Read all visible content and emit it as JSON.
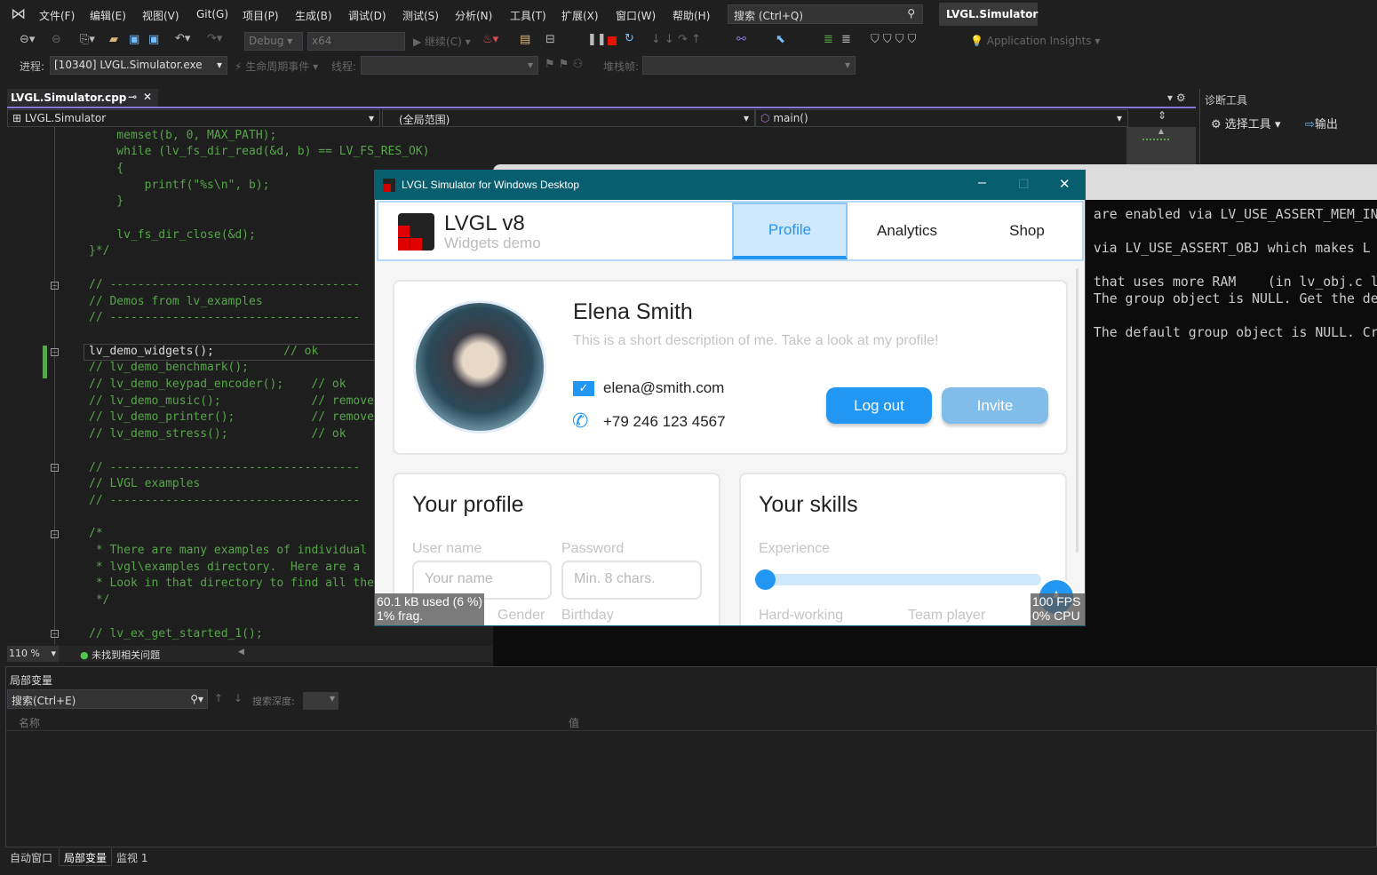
{
  "menubar": {
    "items": [
      "文件(F)",
      "编辑(E)",
      "视图(V)",
      "Git(G)",
      "项目(P)",
      "生成(B)",
      "调试(D)",
      "测试(S)",
      "分析(N)",
      "工具(T)",
      "扩展(X)",
      "窗口(W)",
      "帮助(H)"
    ],
    "search_placeholder": "搜索 (Ctrl+Q)",
    "solution": "LVGL.Simulator"
  },
  "toolbar": {
    "config": "Debug",
    "platform": "x64",
    "continue": "继续(C)",
    "app_insights": "Application Insights",
    "process_label": "进程:",
    "process": "[10340] LVGL.Simulator.exe",
    "lifecycle": "生命周期事件",
    "thread_label": "线程:",
    "stack_label": "堆栈帧:"
  },
  "editor": {
    "tab": "LVGL.Simulator.cpp",
    "nav_project": "LVGL.Simulator",
    "nav_scope": "(全局范围)",
    "nav_member": "main()",
    "zoom": "110 %",
    "issues": "未找到相关问题",
    "lines": [
      "    memset(b, 0, MAX_PATH);",
      "    while (lv_fs_dir_read(&d, b) == LV_FS_RES_OK)",
      "    {",
      "        printf(\"%s\\n\", b);",
      "    }",
      "",
      "    lv_fs_dir_close(&d);",
      "}*/",
      "",
      "// ------------------------------------",
      "// Demos from lv_examples",
      "// ------------------------------------",
      "",
      "lv_demo_widgets();          // ok",
      "// lv_demo_benchmark();",
      "// lv_demo_keypad_encoder();    // ok",
      "// lv_demo_music();             // remove",
      "// lv_demo_printer();           // remove",
      "// lv_demo_stress();            // ok",
      "",
      "// ------------------------------------",
      "// LVGL examples",
      "// ------------------------------------",
      "",
      "/*",
      " * There are many examples of individual",
      " * lvgl\\examples directory.  Here are a",
      " * Look in that directory to find all the",
      " */",
      "",
      "// lv_ex_get_started_1();"
    ]
  },
  "diag": {
    "title": "诊断工具",
    "select_tools": "选择工具",
    "output": "输出"
  },
  "console": {
    "lines": [
      " are enabled via LV_USE_ASSERT_MEM_IN",
      "",
      "d via LV_USE_ASSERT_OBJ which makes L",
      "",
      " that uses more RAM    (in lv_obj.c l",
      " The group object is NULL. Get the de",
      "",
      " The default group object is NULL. Cr"
    ]
  },
  "lvgl": {
    "window_title": "LVGL Simulator for Windows Desktop",
    "logo_title": "LVGL v8",
    "logo_subtitle": "Widgets demo",
    "tabs": [
      "Profile",
      "Analytics",
      "Shop"
    ],
    "active_tab": "Profile",
    "profile": {
      "name": "Elena Smith",
      "description": "This is a short description of me. Take a look at my profile!",
      "email": "elena@smith.com",
      "phone": "+79 246 123 4567",
      "logout": "Log out",
      "invite": "Invite"
    },
    "your_profile": {
      "title": "Your profile",
      "username_label": "User name",
      "username_placeholder": "Your name",
      "password_label": "Password",
      "password_placeholder": "Min. 8 chars.",
      "gender_label": "Gender",
      "birthday_label": "Birthday"
    },
    "skills": {
      "title": "Your skills",
      "experience_label": "Experience",
      "experience_value": 0,
      "hard_working_label": "Hard-working",
      "team_player_label": "Team player"
    },
    "mem": "60.1 kB used (6 %)",
    "frag": "1% frag.",
    "fps": "100 FPS",
    "cpu": "0% CPU",
    "accent": "#2196f3"
  },
  "locals": {
    "title": "局部变量",
    "search_placeholder": "搜索(Ctrl+E)",
    "depth_label": "搜索深度:",
    "col_name": "名称",
    "col_value": "值"
  },
  "bottom_tabs": [
    "自动窗口",
    "局部变量",
    "监视 1"
  ]
}
